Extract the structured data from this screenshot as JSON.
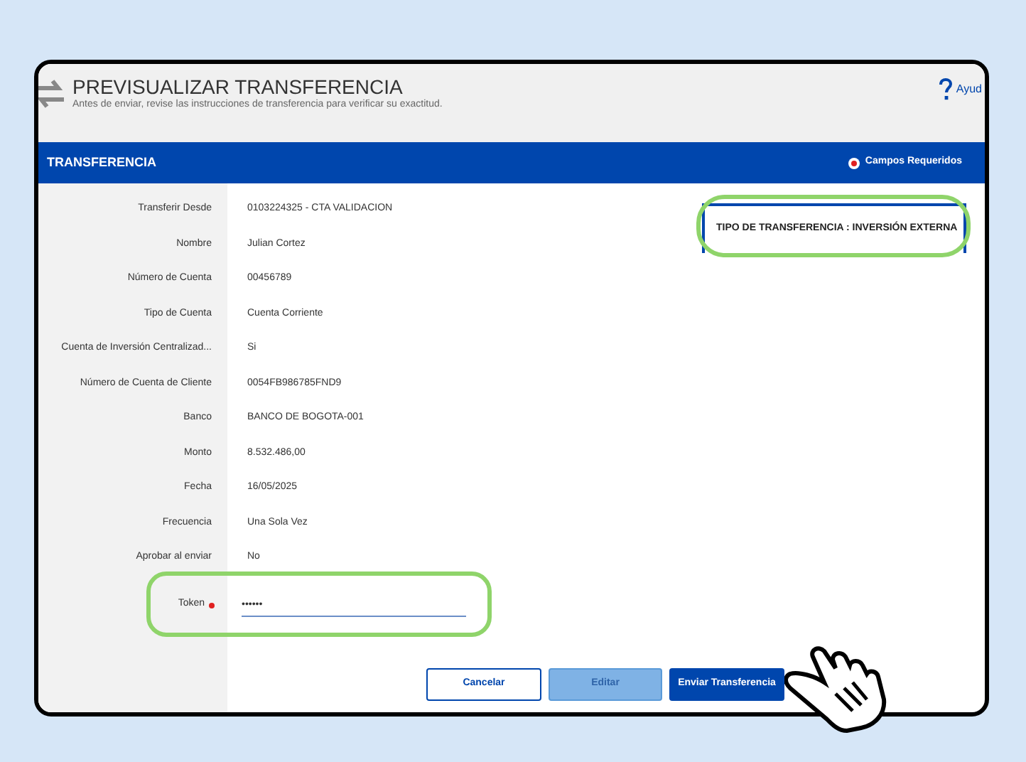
{
  "header": {
    "title": "PREVISUALIZAR TRANSFERENCIA",
    "subtitle": "Antes de enviar, revise las instrucciones de transferencia para verificar su exactitud.",
    "help": "Ayud"
  },
  "section": {
    "title": "TRANSFERENCIA",
    "required_note": "Campos Requeridos"
  },
  "fields": [
    {
      "label": "Transferir Desde",
      "value": "0103224325 - CTA VALIDACION"
    },
    {
      "label": "Nombre",
      "value": "Julian Cortez"
    },
    {
      "label": "Número de Cuenta",
      "value": "00456789"
    },
    {
      "label": "Tipo de Cuenta",
      "value": "Cuenta Corriente"
    },
    {
      "label": "Cuenta de Inversión Centralizad...",
      "value": "Si"
    },
    {
      "label": "Número de Cuenta de Cliente",
      "value": "0054FB986785FND9"
    },
    {
      "label": "Banco",
      "value": "BANCO DE BOGOTA-001"
    },
    {
      "label": "Monto",
      "value": "8.532.486,00"
    },
    {
      "label": "Fecha",
      "value": "16/05/2025"
    },
    {
      "label": "Frecuencia",
      "value": "Una Sola Vez"
    },
    {
      "label": "Aprobar al enviar",
      "value": "No"
    }
  ],
  "token": {
    "label": "Token",
    "required": true,
    "value": "••••••"
  },
  "transfer_type": "TIPO DE TRANSFERENCIA : INVERSIÓN EXTERNA",
  "buttons": [
    {
      "label": "Cancelar",
      "kind": "outline"
    },
    {
      "label": "Editar",
      "kind": "light"
    },
    {
      "label": "Enviar Transferencia",
      "kind": "primary"
    }
  ]
}
